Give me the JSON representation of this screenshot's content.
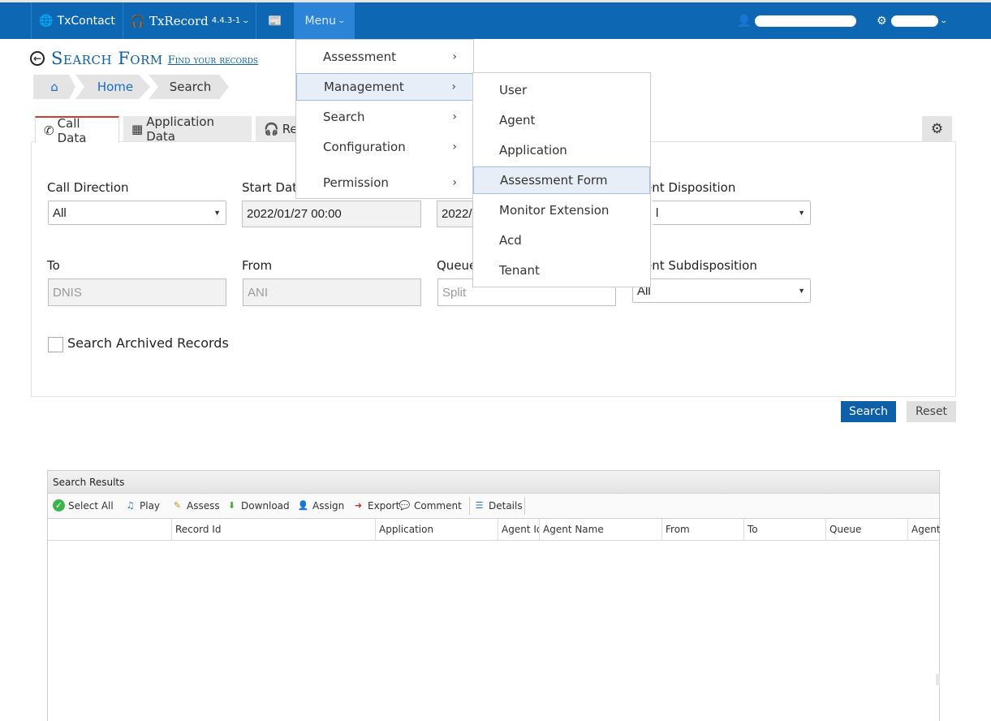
{
  "nav": {
    "brand1": "TxContact",
    "brand2": "TxRecord",
    "version": "4.4.3-1",
    "menu_label": "Menu"
  },
  "page": {
    "title": "Search Form",
    "subtitle": "Find your records"
  },
  "breadcrumb": [
    "Home",
    "Search"
  ],
  "tabs": [
    "Call Data",
    "Application Data",
    "Re"
  ],
  "form": {
    "call_direction_label": "Call Direction",
    "call_direction_value": "All",
    "start_date_label": "Start Dat",
    "start_date_value": "2022/01/27 00:00",
    "end_date_value": "2022/",
    "agent_disposition_label": "ent Disposition",
    "agent_disposition_value": "l",
    "to_label": "To",
    "to_placeholder": "DNIS",
    "from_label": "From",
    "from_placeholder": "ANI",
    "queue_label": "Queue",
    "queue_placeholder": "Split",
    "agent_subdisposition_label": "ent Subdisposition",
    "agent_subdisposition_value": "All",
    "archived_label": "Search Archived Records"
  },
  "buttons": {
    "search": "Search",
    "reset": "Reset"
  },
  "results": {
    "title": "Search Results",
    "toolbar": [
      "Select All",
      "Play",
      "Assess",
      "Download",
      "Assign",
      "Export",
      "Comment",
      "Details"
    ],
    "columns": [
      "",
      "Record Id",
      "Application",
      "Agent Id",
      "Agent Name",
      "From",
      "To",
      "Queue",
      "Agent"
    ]
  },
  "menu": {
    "items": [
      "Assessment",
      "Management",
      "Search",
      "Configuration",
      "Permission"
    ],
    "active": "Management",
    "submenu": [
      "User",
      "Agent",
      "Application",
      "Assessment Form",
      "Monitor Extension",
      "Acd",
      "Tenant"
    ],
    "submenu_active": "Assessment Form"
  },
  "colors": {
    "navbar": "#0d67b3",
    "accent_red": "#d63b2b",
    "primary_button": "#0d5fa8"
  }
}
